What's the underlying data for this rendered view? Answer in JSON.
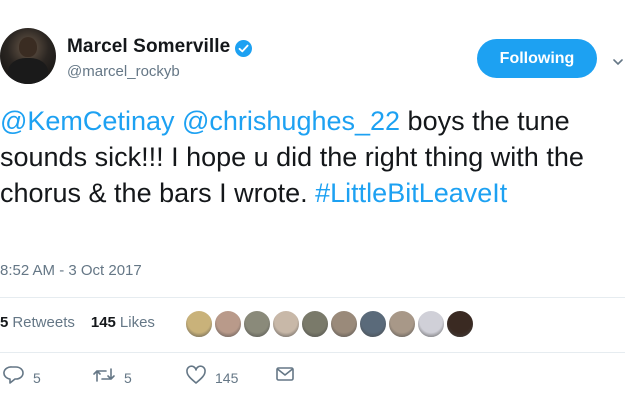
{
  "author": {
    "display_name": "Marcel Somerville",
    "handle": "@marcel_rockyb",
    "verified": true
  },
  "follow_button": {
    "label": "Following"
  },
  "tweet": {
    "segments": [
      {
        "text": "@KemCetinay",
        "type": "link"
      },
      {
        "text": " ",
        "type": "text"
      },
      {
        "text": "@chrishughes_22",
        "type": "link"
      },
      {
        "text": " boys the tune sounds sick!!! I hope u did the right thing with the chorus & the bars I wrote. ",
        "type": "text"
      },
      {
        "text": "#LittleBitLeaveIt",
        "type": "link"
      }
    ],
    "timestamp": "8:52 AM - 3 Oct 2017"
  },
  "stats": {
    "retweets_count": "5",
    "retweets_label": "Retweets",
    "likes_count": "145",
    "likes_label": "Likes"
  },
  "likers": [
    {
      "name": "liker-1",
      "color": "#c9b27a"
    },
    {
      "name": "liker-2",
      "color": "#b99a8a"
    },
    {
      "name": "liker-3",
      "color": "#8a8a7a"
    },
    {
      "name": "liker-4",
      "color": "#c8b8a8"
    },
    {
      "name": "liker-5",
      "color": "#7a7a6a"
    },
    {
      "name": "liker-6",
      "color": "#9a8a7a"
    },
    {
      "name": "liker-7",
      "color": "#5a6a7a"
    },
    {
      "name": "liker-8",
      "color": "#a89888"
    },
    {
      "name": "liker-9",
      "color": "#d0d0d8"
    },
    {
      "name": "liker-10",
      "color": "#3a2a22"
    }
  ],
  "actions": {
    "reply_count": "5",
    "retweet_count": "5",
    "like_count": "145"
  },
  "colors": {
    "accent": "#1da1f2",
    "text_primary": "#14171a",
    "text_secondary": "#657786",
    "divider": "#e6ecf0"
  }
}
